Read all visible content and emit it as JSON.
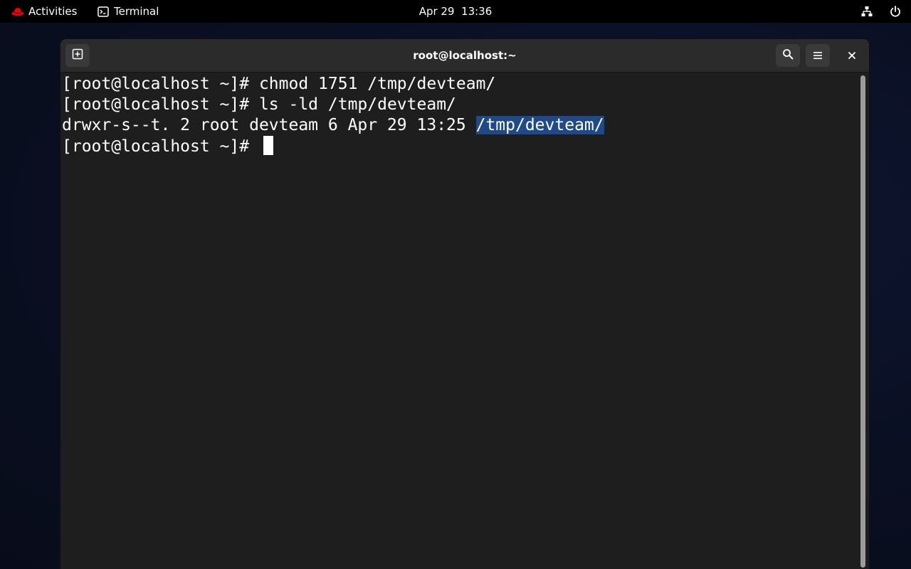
{
  "topbar": {
    "activities_label": "Activities",
    "app_label": "Terminal",
    "clock": "Apr 29  13:36",
    "icons": {
      "brand": "redhat-hat-icon",
      "app": "terminal-icon",
      "network": "network-icon",
      "power": "power-icon"
    }
  },
  "window": {
    "title": "root@localhost:~",
    "buttons": {
      "new_tab": "new-tab-icon",
      "search": "search-icon",
      "menu": "hamburger-menu-icon",
      "close": "close-icon"
    }
  },
  "terminal": {
    "lines": [
      {
        "text": "[root@localhost ~]# chmod 1751 /tmp/devteam/"
      },
      {
        "text": "[root@localhost ~]# ls -ld /tmp/devteam/"
      },
      {
        "text": "drwxr-s--t. 2 root devteam 6 Apr 29 13:25 ",
        "selected": "/tmp/devteam/"
      },
      {
        "text": "[root@localhost ~]# "
      }
    ]
  },
  "colors": {
    "brand_red": "#ee0000",
    "selection": "#1f4a8a",
    "terminal_bg": "#1e1e1e",
    "headerbar_bg": "#2b2b2b"
  }
}
